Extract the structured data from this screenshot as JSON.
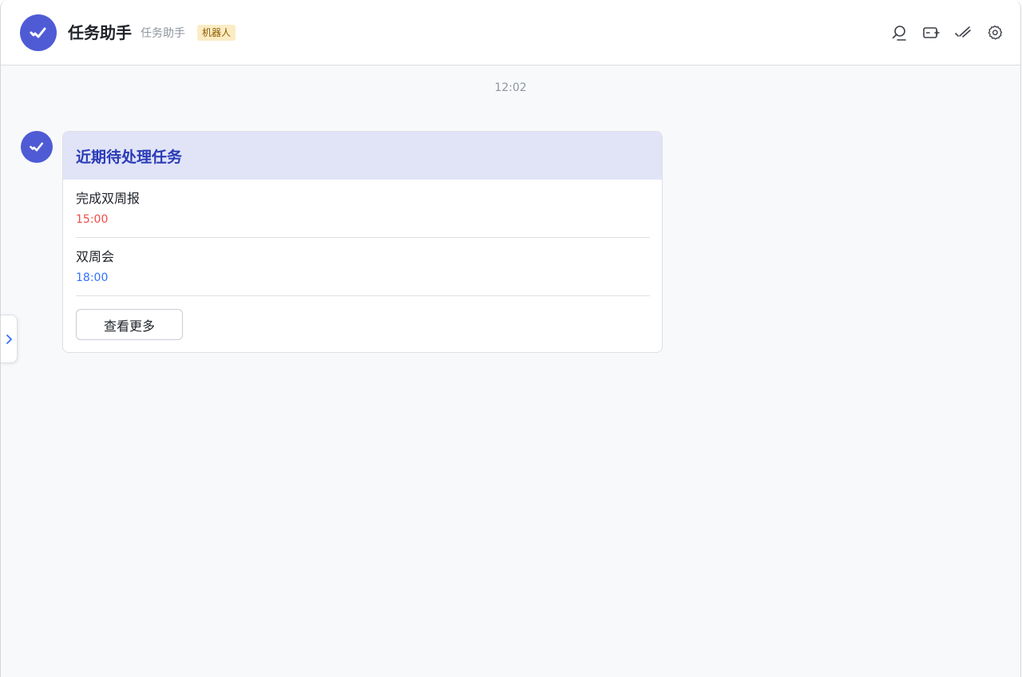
{
  "header": {
    "title": "任务助手",
    "subtitle": "任务助手",
    "badge": "机器人",
    "accent_color": "#4f5bd5",
    "toolbar_icons": [
      "search-icon",
      "add-card-icon",
      "done-check-icon",
      "settings-icon"
    ]
  },
  "chat": {
    "timestamp": "12:02",
    "card": {
      "title": "近期待处理任务",
      "tasks": [
        {
          "name": "完成双周报",
          "time": "15:00",
          "time_color": "#f54a45"
        },
        {
          "name": "双周会",
          "time": "18:00",
          "time_color": "#3370ff"
        }
      ],
      "more_label": "查看更多"
    }
  },
  "sidebar_toggle": {
    "icon": "chevron-right-icon"
  }
}
